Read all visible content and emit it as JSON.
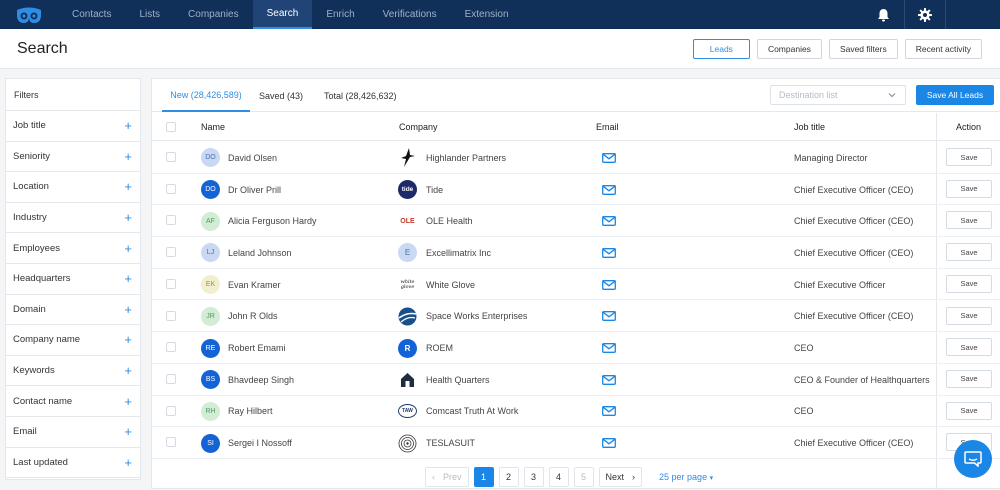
{
  "nav": {
    "items": [
      "Contacts",
      "Lists",
      "Companies",
      "Search",
      "Enrich",
      "Verifications",
      "Extension"
    ],
    "active": "Search"
  },
  "header": {
    "title": "Search",
    "buttons": [
      "Leads",
      "Companies",
      "Saved filters",
      "Recent activity"
    ]
  },
  "filters": {
    "title": "Filters",
    "items": [
      "Job title",
      "Seniority",
      "Location",
      "Industry",
      "Employees",
      "Headquarters",
      "Domain",
      "Company name",
      "Keywords",
      "Contact name",
      "Email",
      "Last updated"
    ]
  },
  "tabs": [
    "New (28,426,589)",
    "Saved (43)",
    "Total (28,426,632)"
  ],
  "destination": {
    "placeholder": "Destination list"
  },
  "save_all_label": "Save All Leads",
  "columns": {
    "name": "Name",
    "company": "Company",
    "email": "Email",
    "job_title": "Job title",
    "action": "Action"
  },
  "save_label": "Save",
  "rows": [
    {
      "initials": "DO",
      "name": "David Olsen",
      "company": "Highlander Partners",
      "title": "Managing Director",
      "avatar_bg": "#c9d9f3",
      "avatar_fg": "#4a6fa8",
      "logo": "star"
    },
    {
      "initials": "DO",
      "name": "Dr Oliver Prill",
      "company": "Tide",
      "title": "Chief Executive Officer (CEO)",
      "avatar_bg": "#1463d6",
      "avatar_fg": "#ffffff",
      "logo": "tide",
      "logo_text": "tide"
    },
    {
      "initials": "AF",
      "name": "Alicia Ferguson Hardy",
      "company": "OLE Health",
      "title": "Chief Executive Officer (CEO)",
      "avatar_bg": "#d3ecd6",
      "avatar_fg": "#4e9a5b",
      "logo": "ole",
      "logo_text": "OLE"
    },
    {
      "initials": "LJ",
      "name": "Leland Johnson",
      "company": "Excellimatrix Inc",
      "title": "Chief Executive Officer (CEO)",
      "avatar_bg": "#c9d9f3",
      "avatar_fg": "#4a6fa8",
      "logo": "letter",
      "logo_text": "E"
    },
    {
      "initials": "EK",
      "name": "Evan Kramer",
      "company": "White Glove",
      "title": "Chief Executive Officer",
      "avatar_bg": "#f1efcf",
      "avatar_fg": "#9a9140",
      "logo": "wg",
      "logo_text": "white glove"
    },
    {
      "initials": "JR",
      "name": "John R Olds",
      "company": "Space Works Enterprises",
      "title": "Chief Executive Officer (CEO)",
      "avatar_bg": "#d3ecd6",
      "avatar_fg": "#4e9a5b",
      "logo": "globe"
    },
    {
      "initials": "RE",
      "name": "Robert Emami",
      "company": "ROEM",
      "title": "CEO",
      "avatar_bg": "#1463d6",
      "avatar_fg": "#ffffff",
      "logo": "rcircle",
      "logo_text": "R"
    },
    {
      "initials": "BS",
      "name": "Bhavdeep Singh",
      "company": "Health Quarters",
      "title": "CEO & Founder of Healthquarters",
      "avatar_bg": "#1463d6",
      "avatar_fg": "#ffffff",
      "logo": "house"
    },
    {
      "initials": "RH",
      "name": "Ray Hilbert",
      "company": "Comcast Truth At Work",
      "title": "CEO",
      "avatar_bg": "#d3ecd6",
      "avatar_fg": "#4e9a5b",
      "logo": "taw",
      "logo_text": "TAW"
    },
    {
      "initials": "SI",
      "name": "Sergei I Nossoff",
      "company": "TESLASUIT",
      "title": "Chief Executive Officer (CEO)",
      "avatar_bg": "#1463d6",
      "avatar_fg": "#ffffff",
      "logo": "spiral"
    }
  ],
  "pagination": {
    "prev": "Prev",
    "pages": [
      "1",
      "2",
      "3",
      "4",
      "5"
    ],
    "active": "1",
    "next": "Next",
    "per_page": "25 per page"
  },
  "accent": "#1a86e6"
}
